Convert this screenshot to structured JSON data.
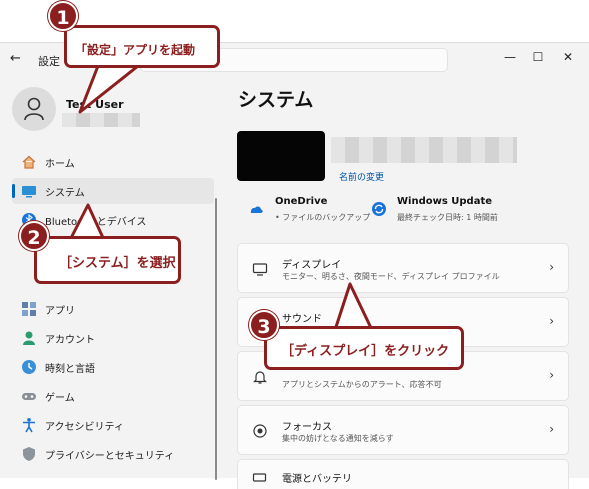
{
  "window": {
    "back_icon": "←",
    "title": "設定",
    "minimize_icon": "—",
    "maximize_icon": "☐",
    "close_icon": "✕"
  },
  "user": {
    "name": "Test User"
  },
  "nav": {
    "items": [
      {
        "label": "ホーム",
        "icon": "home-icon"
      },
      {
        "label": "システム",
        "icon": "system-icon",
        "selected": true
      },
      {
        "label": "Bluetooth とデバイス",
        "icon": "bluetooth-icon"
      },
      {
        "label": "アプリ",
        "icon": "apps-icon"
      },
      {
        "label": "アカウント",
        "icon": "account-icon"
      },
      {
        "label": "時刻と言語",
        "icon": "time-language-icon"
      },
      {
        "label": "ゲーム",
        "icon": "gaming-icon"
      },
      {
        "label": "アクセシビリティ",
        "icon": "accessibility-icon"
      },
      {
        "label": "プライバシーとセキュリティ",
        "icon": "privacy-icon"
      }
    ]
  },
  "main": {
    "title": "システム",
    "rename_link": "名前の変更",
    "services": [
      {
        "title": "OneDrive",
        "subtitle": "• ファイルのバックアップ",
        "icon": "onedrive-icon"
      },
      {
        "title": "Windows Update",
        "subtitle": "最終チェック日時: 1 時間前",
        "icon": "windows-update-icon"
      }
    ],
    "cards": [
      {
        "title": "ディスプレイ",
        "subtitle": "モニター、明るさ、夜間モード、ディスプレイ プロファイル",
        "icon": "display-icon"
      },
      {
        "title": "サウンド",
        "subtitle": "",
        "icon": "sound-icon"
      },
      {
        "title": "",
        "subtitle": "アプリとシステムからのアラート、応答不可",
        "icon": "notification-icon"
      },
      {
        "title": "フォーカス",
        "subtitle": "集中の妨げとなる通知を減らす",
        "icon": "focus-icon"
      },
      {
        "title": "電源とバッテリ",
        "subtitle": "",
        "icon": "power-icon"
      }
    ],
    "chevron": "›"
  },
  "annotations": [
    {
      "number": "1",
      "text": "「設定」アプリを起動"
    },
    {
      "number": "2",
      "text": "［システム］を選択"
    },
    {
      "number": "3",
      "text": "［ディスプレイ］をクリック"
    }
  ],
  "colors": {
    "accent": "#0067c0",
    "callout": "#8b1e1e",
    "background": "#f3f3f3"
  }
}
